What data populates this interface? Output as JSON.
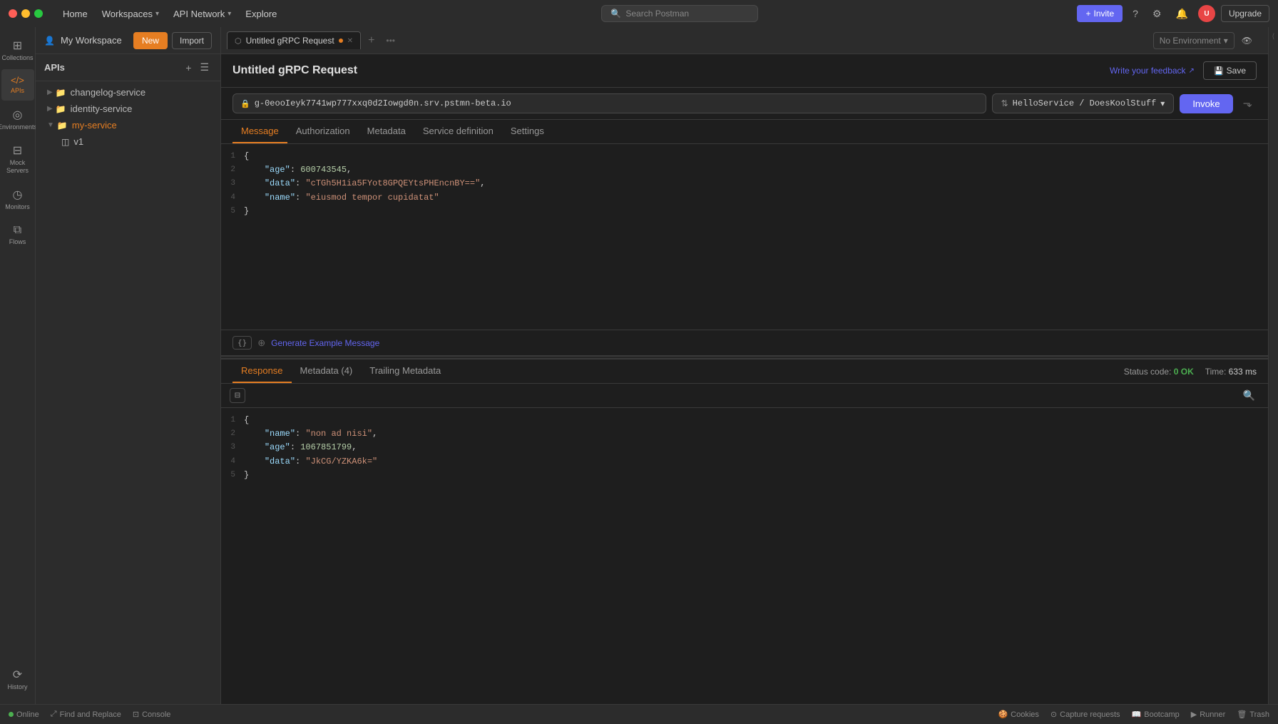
{
  "titlebar": {
    "nav_items": [
      {
        "id": "home",
        "label": "Home"
      },
      {
        "id": "workspaces",
        "label": "Workspaces",
        "has_chevron": true
      },
      {
        "id": "api_network",
        "label": "API Network",
        "has_chevron": true
      },
      {
        "id": "explore",
        "label": "Explore"
      }
    ],
    "search_placeholder": "Search Postman",
    "invite_label": "Invite",
    "upgrade_label": "Upgrade"
  },
  "sidebar": {
    "workspace_label": "My Workspace",
    "new_label": "New",
    "import_label": "Import",
    "icons": [
      {
        "id": "collections",
        "label": "Collections",
        "icon": "⊞"
      },
      {
        "id": "apis",
        "label": "APIs",
        "icon": "⟨⟩",
        "active": true
      },
      {
        "id": "environments",
        "label": "Environments",
        "icon": "⊙"
      },
      {
        "id": "mock-servers",
        "label": "Mock Servers",
        "icon": "⊡"
      },
      {
        "id": "monitors",
        "label": "Monitors",
        "icon": "◷"
      },
      {
        "id": "flows",
        "label": "Flows",
        "icon": "⧉"
      },
      {
        "id": "history",
        "label": "History",
        "icon": "◷"
      }
    ],
    "tree": [
      {
        "id": "changelog-service",
        "label": "changelog-service",
        "type": "folder",
        "level": 0,
        "expanded": false
      },
      {
        "id": "identity-service",
        "label": "identity-service",
        "type": "folder",
        "level": 0,
        "expanded": false
      },
      {
        "id": "my-service",
        "label": "my-service",
        "type": "folder",
        "level": 0,
        "expanded": true,
        "children": [
          {
            "id": "v1",
            "label": "v1",
            "type": "version",
            "level": 1
          }
        ]
      }
    ]
  },
  "tabs": [
    {
      "id": "grpc-request",
      "label": "Untitled gRPC Request",
      "active": true,
      "has_dot": true
    }
  ],
  "request": {
    "title": "Untitled gRPC Request",
    "feedback_label": "Write your feedback",
    "save_label": "Save",
    "url": "g-0eooIeyk7741wp777xxq0d2Iowgd0n.srv.pstmn-beta.io",
    "service": "HelloService / DoesKoolStuff",
    "service_display": "HelloService / DoesKoolStuff",
    "invoke_label": "Invoke",
    "sub_tabs": [
      "Message",
      "Authorization",
      "Metadata",
      "Service definition",
      "Settings"
    ],
    "active_sub_tab": "Message",
    "message_lines": [
      {
        "num": 1,
        "content": "{"
      },
      {
        "num": 2,
        "content": "    \"age\": 600743545,"
      },
      {
        "num": 3,
        "content": "    \"data\": \"cTGh5H1ia5FYot8GPQEYtsPHEncnBY==\","
      },
      {
        "num": 4,
        "content": "    \"name\": \"eiusmod tempor cupidatat\""
      },
      {
        "num": 5,
        "content": "}"
      }
    ]
  },
  "generate": {
    "label": "Generate Example Message"
  },
  "response": {
    "tabs": [
      "Response",
      "Metadata (4)",
      "Trailing Metadata"
    ],
    "active_tab": "Response",
    "status_code": "0 OK",
    "time": "633 ms",
    "lines": [
      {
        "num": 1,
        "content": "{"
      },
      {
        "num": 2,
        "content": "    \"name\": \"non ad nisi\","
      },
      {
        "num": 3,
        "content": "    \"age\": 1067851799,"
      },
      {
        "num": 4,
        "content": "    \"data\": \"JkCG/YZKA6k=\""
      },
      {
        "num": 5,
        "content": "}"
      }
    ]
  },
  "environment": {
    "label": "No Environment"
  },
  "bottom_bar": {
    "online_label": "Online",
    "find_replace_label": "Find and Replace",
    "console_label": "Console",
    "cookies_label": "Cookies",
    "capture_label": "Capture requests",
    "bootcamp_label": "Bootcamp",
    "runner_label": "Runner",
    "trash_label": "Trash"
  }
}
